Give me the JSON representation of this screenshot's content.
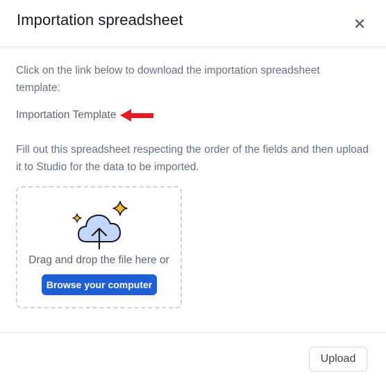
{
  "dialog": {
    "title": "Importation spreadsheet",
    "close_icon": "close-icon"
  },
  "content": {
    "intro_text": "Click on the link below to download the importation spreadsheet template:",
    "template_link": "Importation Template",
    "annotation_arrow": {
      "icon": "arrow-left-icon",
      "color": "#e31b23"
    },
    "instructions": "Fill out this spreadsheet respecting the order of the fields and then upload it to Studio for the data to be imported."
  },
  "dropzone": {
    "icon": "cloud-upload-icon",
    "text": "Drag and drop the file here or",
    "browse_label": "Browse your computer"
  },
  "footer": {
    "upload_label": "Upload"
  },
  "colors": {
    "primary": "#1e5fd6",
    "sparkle": "#f5b731",
    "cloud_fill": "#c3d6fb"
  }
}
